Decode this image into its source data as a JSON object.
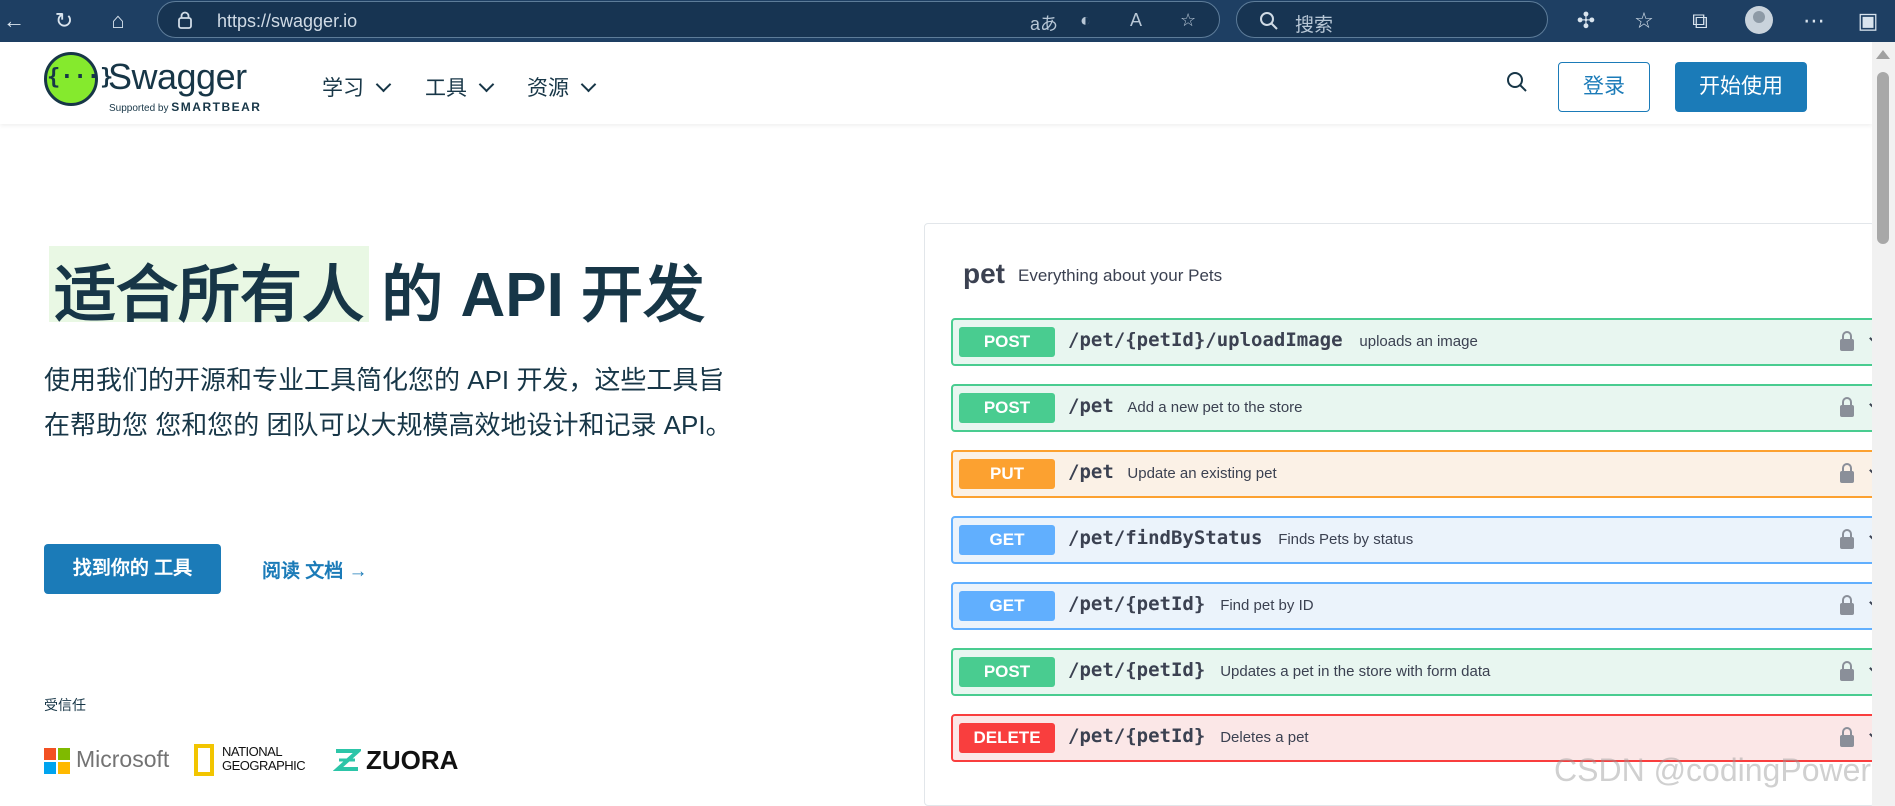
{
  "browser": {
    "url": "https://swagger.io",
    "search_placeholder": "搜索",
    "read_aloud_label": "aあ"
  },
  "nav": {
    "logo_mark": "{···}",
    "logo_text": "Swagger",
    "logo_sub_prefix": "Supported by",
    "logo_sub_brand": "SMARTBEAR",
    "menu": [
      "学习",
      "工具",
      "资源"
    ],
    "login": "登录",
    "start": "开始使用"
  },
  "hero": {
    "title_highlight": "适合所有人",
    "title_rest": " 的 API 开发",
    "description": "使用我们的开源和专业工具简化您的 API 开发，这些工具旨在帮助您 您和您的 团队可以大规模高效地设计和记录 API。",
    "cta_primary": "找到你的 工具",
    "cta_link": "阅读 文档 →",
    "trusted": "受信任",
    "brands": {
      "microsoft": "Microsoft",
      "natgeo_line1": "NATIONAL",
      "natgeo_line2": "GEOGRAPHIC",
      "zuora": "ZUORA"
    }
  },
  "swagger_panel": {
    "tag": "pet",
    "tag_description": "Everything about your Pets",
    "operations": [
      {
        "method": "POST",
        "path": "/pet/{petId}/uploadImage",
        "summary": "uploads an image",
        "color": "#49cc90",
        "bg": "#e8f6f0"
      },
      {
        "method": "POST",
        "path": "/pet",
        "summary": "Add a new pet to the store",
        "color": "#49cc90",
        "bg": "#e8f6f0"
      },
      {
        "method": "PUT",
        "path": "/pet",
        "summary": "Update an existing pet",
        "color": "#fca130",
        "bg": "#fbf1e6"
      },
      {
        "method": "GET",
        "path": "/pet/findByStatus",
        "summary": "Finds Pets by status",
        "color": "#61affe",
        "bg": "#ebf3fb"
      },
      {
        "method": "GET",
        "path": "/pet/{petId}",
        "summary": "Find pet by ID",
        "color": "#61affe",
        "bg": "#ebf3fb"
      },
      {
        "method": "POST",
        "path": "/pet/{petId}",
        "summary": "Updates a pet in the store with form data",
        "color": "#49cc90",
        "bg": "#e8f6f0"
      },
      {
        "method": "DELETE",
        "path": "/pet/{petId}",
        "summary": "Deletes a pet",
        "color": "#f93e3e",
        "bg": "#fbe7e7"
      }
    ]
  },
  "watermark": "CSDN @codingPower"
}
